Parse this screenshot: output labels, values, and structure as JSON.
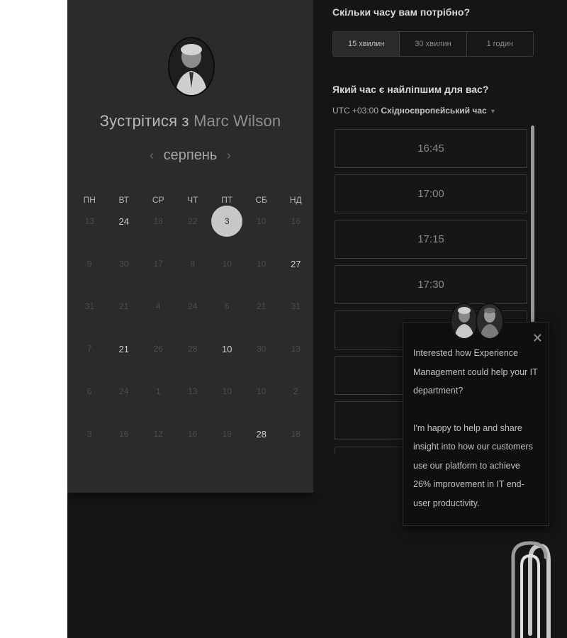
{
  "meeting": {
    "title_prefix": "Зустрітися з",
    "host_name": "Marc Wilson"
  },
  "calendar": {
    "month": "серпень",
    "prev_icon": "chevron-left-icon",
    "next_icon": "chevron-right-icon",
    "weekdays": [
      "ПН",
      "ВТ",
      "СР",
      "ЧТ",
      "ПТ",
      "СБ",
      "НД"
    ],
    "weeks": [
      [
        {
          "d": "13",
          "s": "dim"
        },
        {
          "d": "24",
          "s": "avail"
        },
        {
          "d": "18",
          "s": "dim"
        },
        {
          "d": "22",
          "s": "dim"
        },
        {
          "d": "3",
          "s": "selected"
        },
        {
          "d": "10",
          "s": "dim"
        },
        {
          "d": "16",
          "s": "dim"
        }
      ],
      [
        {
          "d": "9",
          "s": "dim"
        },
        {
          "d": "30",
          "s": "dim"
        },
        {
          "d": "17",
          "s": "dim"
        },
        {
          "d": "8",
          "s": "dim"
        },
        {
          "d": "10",
          "s": "dim"
        },
        {
          "d": "10",
          "s": "dim"
        },
        {
          "d": "27",
          "s": "avail"
        }
      ],
      [
        {
          "d": "31",
          "s": "dim"
        },
        {
          "d": "21",
          "s": "dim"
        },
        {
          "d": "4",
          "s": "dim"
        },
        {
          "d": "24",
          "s": "dim"
        },
        {
          "d": "6",
          "s": "dim"
        },
        {
          "d": "21",
          "s": "dim"
        },
        {
          "d": "31",
          "s": "dim"
        }
      ],
      [
        {
          "d": "7",
          "s": "dim"
        },
        {
          "d": "21",
          "s": "avail"
        },
        {
          "d": "26",
          "s": "dim"
        },
        {
          "d": "28",
          "s": "dim"
        },
        {
          "d": "10",
          "s": "avail"
        },
        {
          "d": "30",
          "s": "dim"
        },
        {
          "d": "13",
          "s": "dim"
        }
      ],
      [
        {
          "d": "6",
          "s": "dim"
        },
        {
          "d": "24",
          "s": "dim"
        },
        {
          "d": "1",
          "s": "dim"
        },
        {
          "d": "13",
          "s": "dim"
        },
        {
          "d": "10",
          "s": "dim"
        },
        {
          "d": "10",
          "s": "dim"
        },
        {
          "d": "2",
          "s": "dim"
        }
      ],
      [
        {
          "d": "3",
          "s": "dim"
        },
        {
          "d": "16",
          "s": "dim"
        },
        {
          "d": "12",
          "s": "dim"
        },
        {
          "d": "16",
          "s": "dim"
        },
        {
          "d": "19",
          "s": "dim"
        },
        {
          "d": "28",
          "s": "avail"
        },
        {
          "d": "18",
          "s": "dim"
        }
      ]
    ]
  },
  "duration": {
    "title": "Скільки часу вам потрібно?",
    "options": [
      "15 хвилин",
      "30 хвилин",
      "1 годин"
    ],
    "selected_index": 0
  },
  "times": {
    "title": "Який час є найліпшим для вас?",
    "timezone_offset": "UTC +03:00",
    "timezone_name": "Східноєвропейський час",
    "slots": [
      "16:45",
      "17:00",
      "17:15",
      "17:30",
      "",
      "",
      "",
      ""
    ]
  },
  "chat": {
    "close_icon": "close-icon",
    "message_1": "Interested how Experience Management could help your IT department?",
    "message_2": "I'm happy to help and share insight into how our customers use our platform to achieve 26% improvement in IT end-user productivity."
  },
  "colors": {
    "app_background": "#151515",
    "panel_background": "#2b2b2b",
    "selected_day": "#c7c7c7",
    "scrollbar": "#9a9a9a"
  }
}
